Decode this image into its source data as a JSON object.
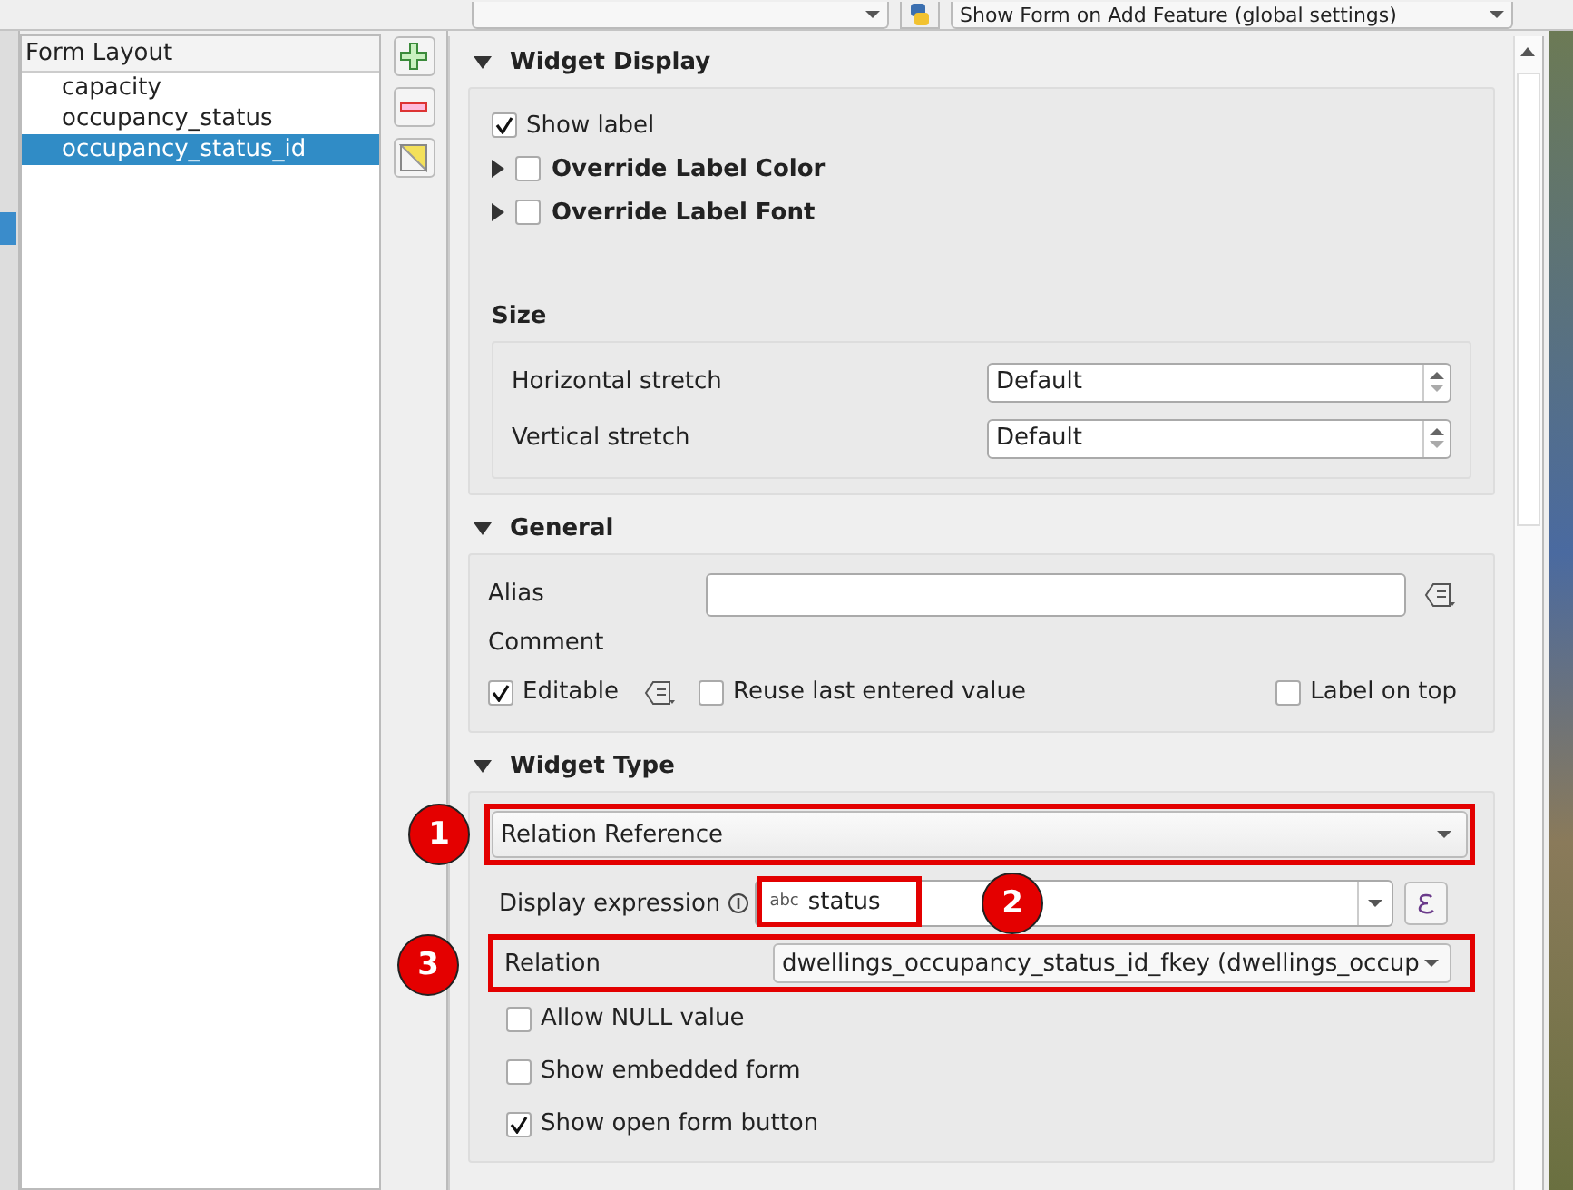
{
  "toolbar": {
    "form_mode": "Show Form on Add Feature (global settings)"
  },
  "tree": {
    "header": "Form Layout",
    "items": [
      {
        "label": "capacity",
        "selected": false
      },
      {
        "label": "occupancy_status",
        "selected": false
      },
      {
        "label": "occupancy_status_id",
        "selected": true
      }
    ]
  },
  "widget_display": {
    "title": "Widget Display",
    "expanded": true,
    "show_label": {
      "label": "Show label",
      "checked": true
    },
    "overrides": [
      {
        "label": "Override Label Color",
        "checked": false,
        "expanded": false
      },
      {
        "label": "Override Label Font",
        "checked": false,
        "expanded": false
      }
    ],
    "size": {
      "title": "Size",
      "rows": [
        {
          "label": "Horizontal stretch",
          "value": "Default"
        },
        {
          "label": "Vertical stretch",
          "value": "Default"
        }
      ]
    }
  },
  "general": {
    "title": "General",
    "expanded": true,
    "alias": {
      "label": "Alias"
    },
    "comment": {
      "label": "Comment"
    },
    "editable": {
      "label": "Editable",
      "checked": true
    },
    "reuse_last": {
      "label": "Reuse last entered value",
      "checked": false
    },
    "label_on_top": {
      "label": "Label on top",
      "checked": false
    }
  },
  "widget_type": {
    "title": "Widget Type",
    "expanded": true,
    "widget": "Relation Reference",
    "display_expression": {
      "label": "Display expression",
      "field_type": "abc",
      "value": "status"
    },
    "relation": {
      "label": "Relation",
      "value": "dwellings_occupancy_status_id_fkey (dwellings_occup"
    },
    "options": [
      {
        "label": "Allow NULL value",
        "checked": false
      },
      {
        "label": "Show embedded form",
        "checked": false
      },
      {
        "label": "Show open form button",
        "checked": true
      }
    ]
  },
  "callouts": [
    "1",
    "2",
    "3"
  ]
}
